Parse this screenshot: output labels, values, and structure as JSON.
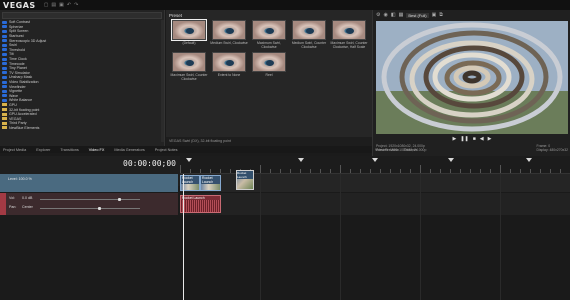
{
  "app": {
    "title": "VEGAS"
  },
  "fx_list": {
    "search": "",
    "items": [
      {
        "type": "fx",
        "label": "Soft Contrast"
      },
      {
        "type": "fx",
        "label": "Spherize"
      },
      {
        "type": "fx",
        "label": "Split Screen"
      },
      {
        "type": "fx",
        "label": "Starburst"
      },
      {
        "type": "fx",
        "label": "Stereoscopic 3D Adjust"
      },
      {
        "type": "fx",
        "label": "Swirl"
      },
      {
        "type": "fx",
        "label": "Threshold"
      },
      {
        "type": "fx",
        "label": "Tilt"
      },
      {
        "type": "fx",
        "label": "Time Clock"
      },
      {
        "type": "fx",
        "label": "Timecode"
      },
      {
        "type": "fx",
        "label": "Tiny Planet"
      },
      {
        "type": "fx",
        "label": "TV Simulator"
      },
      {
        "type": "fx",
        "label": "Unsharp Mask"
      },
      {
        "type": "fx",
        "label": "Video Stabilization"
      },
      {
        "type": "fx",
        "label": "Viewfinder"
      },
      {
        "type": "fx",
        "label": "Vignette"
      },
      {
        "type": "fx",
        "label": "Wave"
      },
      {
        "type": "fx",
        "label": "White Balance"
      },
      {
        "type": "folder",
        "label": "GPU"
      },
      {
        "type": "folder",
        "label": "32-bit floating point"
      },
      {
        "type": "folder",
        "label": "GPU Accelerated"
      },
      {
        "type": "folder",
        "label": "VEGAS"
      },
      {
        "type": "folder",
        "label": "Third Party"
      },
      {
        "type": "folder",
        "label": "NewBlue Elements"
      }
    ]
  },
  "presets": {
    "title": "Preset",
    "items": [
      {
        "label": "(Default)",
        "selected": true
      },
      {
        "label": "Medium Swirl, Clockwise",
        "selected": false
      },
      {
        "label": "Maximum Swirl, Clockwise",
        "selected": false
      },
      {
        "label": "Medium Swirl, Counter Clockwise",
        "selected": false
      },
      {
        "label": "Maximum Swirl, Counter Clockwise, Half Scale",
        "selected": false
      },
      {
        "label": "Maximum Swirl, Counter Clockwise",
        "selected": false
      },
      {
        "label": "Extent to None",
        "selected": false
      },
      {
        "label": "Reel",
        "selected": false
      }
    ],
    "footer": "VEGAS Swirl (DX), 32-bit floating point"
  },
  "tabs": {
    "items": [
      "Project Media",
      "Explorer",
      "Transitions",
      "Video FX",
      "Media Generators"
    ],
    "active": "Video FX",
    "secondary": "Project Notes"
  },
  "preview": {
    "quality": "Best (Full)",
    "project_info": "Project: 1920x1080x32, 24.000p",
    "preview_info": "Preview: 1920x1080x32, 24.000p",
    "display_info": "Display: 480x270x32",
    "frame_info": "Frame: 0",
    "tabs": [
      "Video Preview",
      "Trimmer"
    ]
  },
  "timeline": {
    "timecode": "00:00:00;00",
    "video_track_label": "Level: 100.0 %",
    "audio_vol_label": "Vol:",
    "audio_vol_value": "0.0 dB",
    "audio_pan_label": "Pan:",
    "audio_pan_value": "Center",
    "clip_name": "Rocket Launch"
  },
  "colors": {
    "video_track": "#4a6a80",
    "audio_track": "#a9434d",
    "accent": "#2a6ad6"
  }
}
